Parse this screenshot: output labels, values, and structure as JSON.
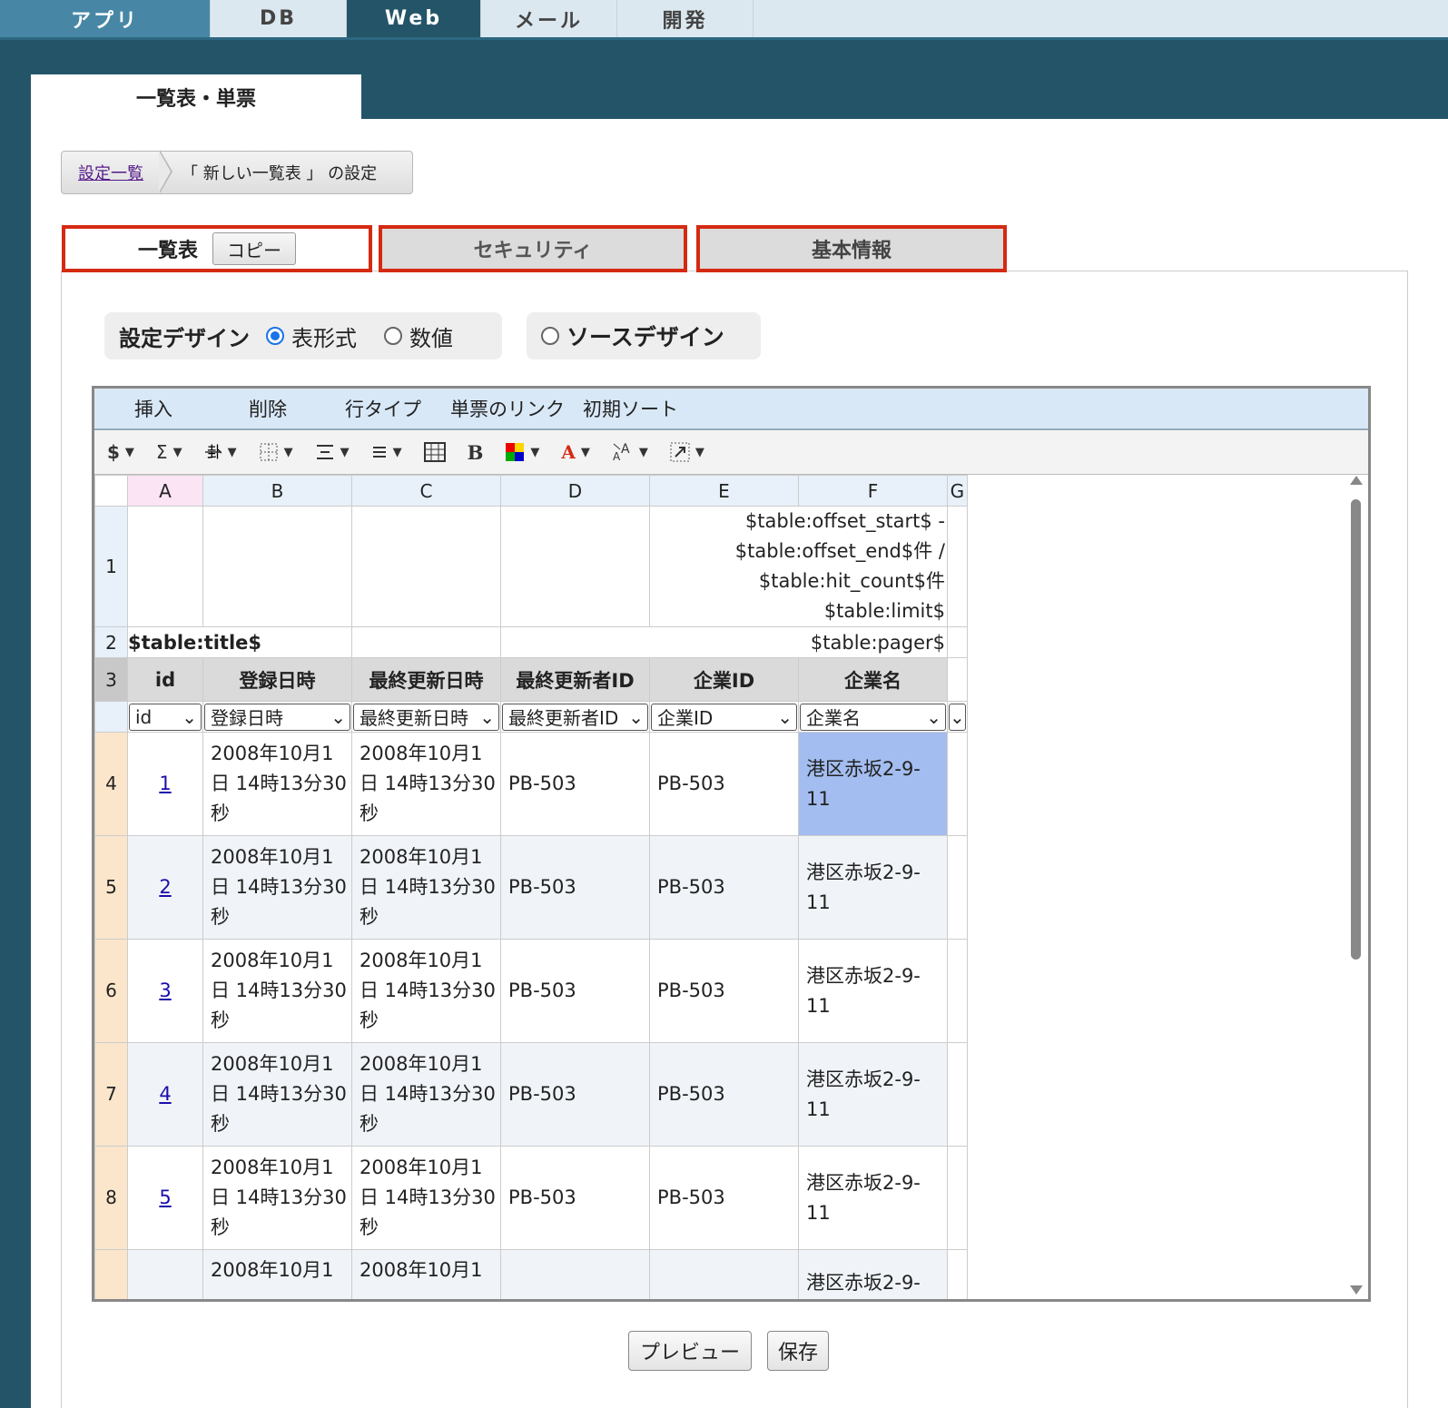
{
  "topnav": {
    "tabs": [
      "アプリ",
      "DB",
      "Web",
      "メール",
      "開発"
    ]
  },
  "page_tab": "一覧表・単票",
  "breadcrumb": {
    "link": "設定一覧",
    "current": "「 新しい一覧表 」 の設定"
  },
  "subtabs": {
    "list": "一覧表",
    "copy": "コピー",
    "security": "セキュリティ",
    "basic": "基本情報"
  },
  "design": {
    "label": "設定デザイン",
    "opt_table": "表形式",
    "opt_numeric": "数値",
    "opt_source": "ソースデザイン",
    "selected": "表形式"
  },
  "menu": [
    "挿入",
    "削除",
    "行タイプ",
    "単票のリンク",
    "初期ソート"
  ],
  "toolbar_icons": [
    "dollar-icon",
    "sigma-icon",
    "strike-icon",
    "border-icon",
    "align-center-icon",
    "align-justify-icon",
    "table-icon",
    "bold-icon",
    "fill-color-icon",
    "font-color-icon",
    "font-size-icon",
    "expand-icon"
  ],
  "toolbar_labels": {
    "dollar": "$",
    "sigma": "Σ",
    "bold": "B",
    "font_color": "A"
  },
  "grid": {
    "columns": [
      "A",
      "B",
      "C",
      "D",
      "E",
      "F",
      "G"
    ],
    "row1": {
      "num": "1",
      "e_lines": [
        "$table:offset_start$ -",
        "$table:offset_end$件 /",
        "$table:hit_count$件",
        "$table:limit$"
      ]
    },
    "row2": {
      "num": "2",
      "title": "$table:title$",
      "pager": "$table:pager$"
    },
    "row3": {
      "num": "3",
      "headers": [
        "id",
        "登録日時",
        "最終更新日時",
        "最終更新者ID",
        "企業ID",
        "企業名"
      ]
    },
    "selects": [
      "id",
      "登録日時",
      "最終更新日時",
      "最終更新者ID",
      "企業ID",
      "企業名"
    ],
    "rows": [
      {
        "num": "4",
        "id": "1",
        "reg": "2008年10月1日 14時13分30秒",
        "upd": "2008年10月1日 14時13分30秒",
        "upd_by": "PB-503",
        "company_id": "PB-503",
        "company": "港区赤坂2-9-11"
      },
      {
        "num": "5",
        "id": "2",
        "reg": "2008年10月1日 14時13分30秒",
        "upd": "2008年10月1日 14時13分30秒",
        "upd_by": "PB-503",
        "company_id": "PB-503",
        "company": "港区赤坂2-9-11"
      },
      {
        "num": "6",
        "id": "3",
        "reg": "2008年10月1日 14時13分30秒",
        "upd": "2008年10月1日 14時13分30秒",
        "upd_by": "PB-503",
        "company_id": "PB-503",
        "company": "港区赤坂2-9-11"
      },
      {
        "num": "7",
        "id": "4",
        "reg": "2008年10月1日 14時13分30秒",
        "upd": "2008年10月1日 14時13分30秒",
        "upd_by": "PB-503",
        "company_id": "PB-503",
        "company": "港区赤坂2-9-11"
      },
      {
        "num": "8",
        "id": "5",
        "reg": "2008年10月1日 14時13分30秒",
        "upd": "2008年10月1日 14時13分30秒",
        "upd_by": "PB-503",
        "company_id": "PB-503",
        "company": "港区赤坂2-9-11"
      },
      {
        "num": "",
        "id": "",
        "reg": "2008年10月1",
        "upd": "2008年10月1",
        "upd_by": "",
        "company_id": "",
        "company": "港区赤坂2-9-"
      }
    ]
  },
  "buttons": {
    "preview": "プレビュー",
    "save": "保存"
  },
  "colors": {
    "nav_dark": "#245468",
    "nav_app": "#4787a5",
    "tab_border_red": "#d42a12",
    "selected_cell": "#a3bdf0"
  }
}
